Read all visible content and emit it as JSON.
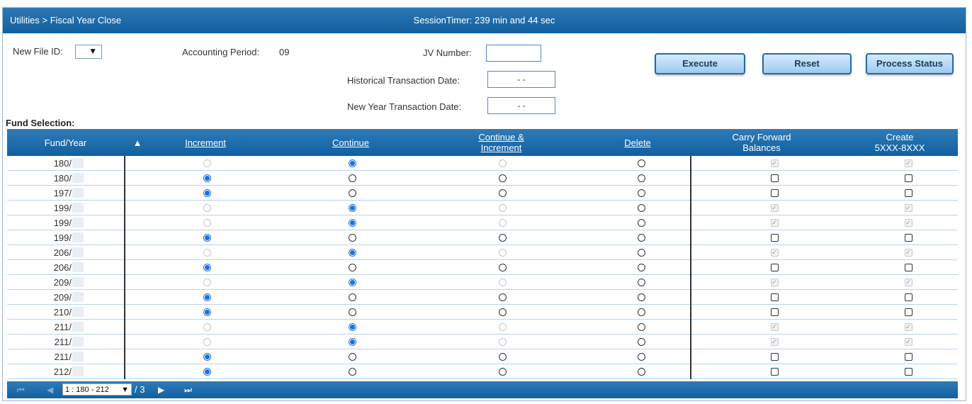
{
  "header": {
    "breadcrumb": "Utilities > Fiscal Year Close",
    "session_timer": "SessionTimer: 239 min and 44 sec"
  },
  "form": {
    "new_file_id_label": "New File ID:",
    "accounting_period_label": "Accounting Period:",
    "accounting_period_value": "09",
    "jv_number_label": "JV Number:",
    "jv_number_value": "",
    "historical_date_label": "Historical Transaction Date:",
    "historical_date_value": "- -",
    "new_year_date_label": "New Year Transaction Date:",
    "new_year_date_value": "- -"
  },
  "buttons": {
    "execute": "Execute",
    "reset": "Reset",
    "process_status": "Process Status"
  },
  "fund_selection_label": "Fund Selection:",
  "columns": {
    "fund_year": "Fund/Year",
    "sort_icon": "▲",
    "increment": "Increment",
    "continue": "Continue",
    "continue_increment_1": "Continue &",
    "continue_increment_2": "Increment",
    "delete": "Delete",
    "carry_forward_1": "Carry Forward",
    "carry_forward_2": "Balances",
    "create_1": "Create",
    "create_2": "5XXX-8XXX"
  },
  "rows": [
    {
      "fund": "180/",
      "selected": "continue",
      "alt": false
    },
    {
      "fund": "180/",
      "selected": "increment",
      "alt": true
    },
    {
      "fund": "197/",
      "selected": "increment",
      "alt": true
    },
    {
      "fund": "199/",
      "selected": "continue",
      "alt": false
    },
    {
      "fund": "199/",
      "selected": "continue",
      "alt": false
    },
    {
      "fund": "199/",
      "selected": "increment",
      "alt": true
    },
    {
      "fund": "206/",
      "selected": "continue",
      "alt": false
    },
    {
      "fund": "206/",
      "selected": "increment",
      "alt": true
    },
    {
      "fund": "209/",
      "selected": "continue",
      "alt": false
    },
    {
      "fund": "209/",
      "selected": "increment",
      "alt": true
    },
    {
      "fund": "210/",
      "selected": "increment",
      "alt": true
    },
    {
      "fund": "211/",
      "selected": "continue",
      "alt": false
    },
    {
      "fund": "211/",
      "selected": "continue",
      "alt": false
    },
    {
      "fund": "211/",
      "selected": "increment",
      "alt": true
    },
    {
      "fund": "212/",
      "selected": "increment",
      "alt": true
    }
  ],
  "pager": {
    "page_select": "1 : 180 - 212",
    "total": "/ 3",
    "first_icon": "⏮",
    "prev_icon": "◀",
    "next_icon": "▶",
    "last_icon": "⏭"
  },
  "colors": {
    "header_blue": "#135f9e",
    "radio_blue": "#1e6fd8",
    "grid_line": "#b8d4ee"
  }
}
